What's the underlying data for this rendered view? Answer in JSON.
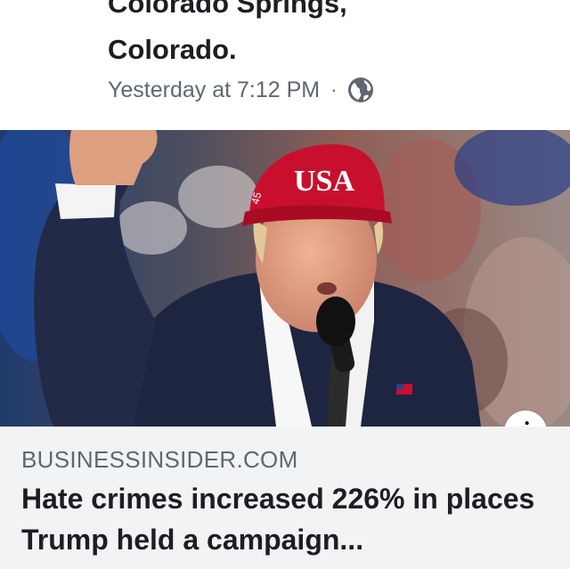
{
  "post": {
    "place_line1": "Colorado Springs,",
    "place_line2": "Colorado.",
    "timestamp": "Yesterday at 7:12 PM",
    "separator": "·",
    "privacy_icon": "globe-icon"
  },
  "photo": {
    "cap_text": "USA",
    "cap_side_text": "45",
    "info_icon": "info-icon",
    "info_label": "i"
  },
  "link_preview": {
    "domain": "BUSINESSINSIDER.COM",
    "title": "Hate crimes increased 226% in places Trump held a campaign..."
  },
  "colors": {
    "text_primary": "#1c1e21",
    "text_secondary": "#606770",
    "link_box_bg": "#f2f3f5",
    "cap_red": "#c8102e"
  }
}
